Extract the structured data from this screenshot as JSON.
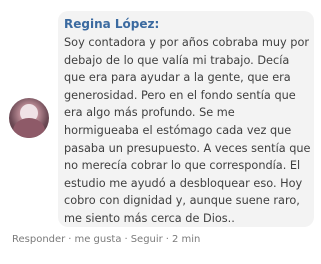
{
  "comment": {
    "author": "Regina López:",
    "text": "Soy contadora y por años cobraba muy por debajo de lo que valía mi trabajo. Decía que era para ayudar a la gente, que era generosidad. Pero en el fondo sentía que era algo más profundo. Se me hormigueaba el estómago cada vez que pasaba un presupuesto. A veces sentía que no merecía cobrar lo que correspondía. El estudio me ayudó a desbloquear eso. Hoy cobro con dignidad y, aunque suene raro, me siento más cerca de Dios..",
    "actions": {
      "reply": "Responder",
      "like": "me gusta",
      "follow": "Seguir",
      "time": "2 min",
      "separator": "·"
    }
  }
}
